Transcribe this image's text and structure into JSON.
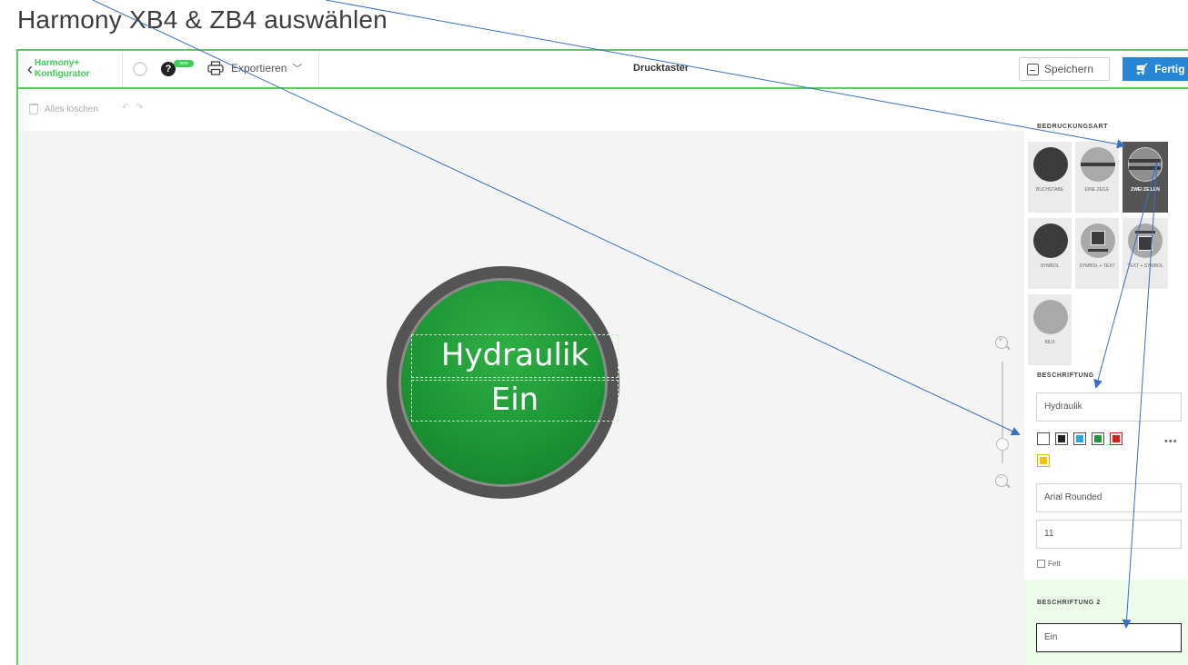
{
  "slide_title": "Harmony XB4 & ZB4 auswählen",
  "topbar": {
    "brand_line1": "Harmony+",
    "brand_line2": "Konfigurator",
    "help_glyph": "?",
    "new_badge": "new",
    "export_label": "Exportieren",
    "document_title": "Drucktaster",
    "save_label": "Speichern",
    "done_label": "Fertig"
  },
  "toolbar": {
    "clear_all_label": "Alles löschen",
    "undo_glyph": "↶",
    "redo_glyph": "↷"
  },
  "canvas": {
    "line1_text": "Hydraulik",
    "line2_text": "Ein",
    "button_color": "#1d9636"
  },
  "panel": {
    "print_type_label": "BEDRUCKUNGSART",
    "print_types": [
      {
        "label": "BUCHSTABE",
        "icon": "solid-circle-icon"
      },
      {
        "label": "EINE ZEILE",
        "icon": "one-line-icon"
      },
      {
        "label": "ZWEI ZEILEN",
        "icon": "two-lines-icon",
        "selected": true
      },
      {
        "label": "SYMBOL",
        "icon": "solid-circle-icon"
      },
      {
        "label": "SYMBOL + TEXT",
        "icon": "symbol-text-icon"
      },
      {
        "label": "TEXT + SYMBOL",
        "icon": "text-symbol-icon"
      },
      {
        "label": "BILD",
        "icon": "image-circle-icon"
      }
    ],
    "caption_label": "BESCHRIFTUNG",
    "caption_value": "Hydraulik",
    "colors": [
      "#ffffff",
      "#222222",
      "#29a8e0",
      "#1e9a3a",
      "#e01a1a",
      "#f5c400"
    ],
    "more_glyph": "•••",
    "font_value": "Arial Rounded",
    "size_value": "11",
    "bold_label": "Fett",
    "caption2_label": "BESCHRIFTUNG 2",
    "caption2_value": "Ein"
  }
}
